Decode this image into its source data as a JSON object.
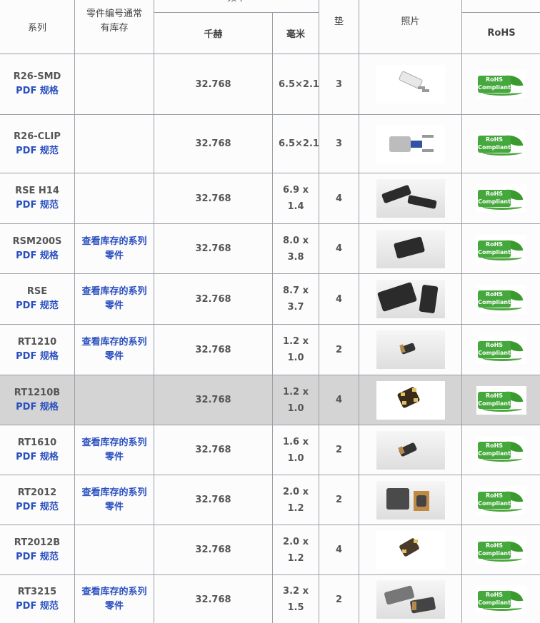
{
  "headers": {
    "series": "系列",
    "part_stock": "零件编号通常有库存",
    "frequency": "频率",
    "khz": "千赫",
    "mm": "毫米",
    "pads": "垫",
    "photo": "照片",
    "rohs": "RoHS"
  },
  "rohs_badge": {
    "line1": "RoHS",
    "line2": "Compliant"
  },
  "rows": [
    {
      "series": "R26-SMD",
      "pdf": "PDF 规格",
      "stock": "",
      "freq": "32.768",
      "size": "6.5×2.1",
      "pads": "3",
      "highlight": false
    },
    {
      "series": "R26-CLIP",
      "pdf": "PDF 规范",
      "stock": "",
      "freq": "32.768",
      "size": "6.5×2.1",
      "pads": "3",
      "highlight": false
    },
    {
      "series": "RSE H14",
      "pdf": "PDF 规范",
      "stock": "",
      "freq": "32.768",
      "size": "6.9 x 1.4",
      "pads": "4",
      "highlight": false
    },
    {
      "series": "RSM200S",
      "pdf": "PDF 规格",
      "stock": "查看库存的系列零件",
      "freq": "32.768",
      "size": "8.0 x 3.8",
      "pads": "4",
      "highlight": false
    },
    {
      "series": "RSE",
      "pdf": "PDF 规范",
      "stock": "查看库存的系列零件",
      "freq": "32.768",
      "size": "8.7 x 3.7",
      "pads": "4",
      "highlight": false
    },
    {
      "series": "RT1210",
      "pdf": "PDF 规格",
      "stock": "查看库存的系列零件",
      "freq": "32.768",
      "size": "1.2 x 1.0",
      "pads": "2",
      "highlight": false
    },
    {
      "series": "RT1210B",
      "pdf": "PDF 规格",
      "stock": "",
      "freq": "32.768",
      "size": "1.2 x 1.0",
      "pads": "4",
      "highlight": true
    },
    {
      "series": "RT1610",
      "pdf": "PDF 规格",
      "stock": "查看库存的系列零件",
      "freq": "32.768",
      "size": "1.6 x 1.0",
      "pads": "2",
      "highlight": false
    },
    {
      "series": "RT2012",
      "pdf": "PDF 规范",
      "stock": "查看库存的系列零件",
      "freq": "32.768",
      "size": "2.0 x 1.2",
      "pads": "2",
      "highlight": false
    },
    {
      "series": "RT2012B",
      "pdf": "PDF 规范",
      "stock": "",
      "freq": "32.768",
      "size": "2.0 x 1.2",
      "pads": "4",
      "highlight": false
    },
    {
      "series": "RT3215",
      "pdf": "PDF 规范",
      "stock": "查看库存的系列零件",
      "freq": "32.768",
      "size": "3.2 x 1.5",
      "pads": "2",
      "highlight": false
    }
  ]
}
